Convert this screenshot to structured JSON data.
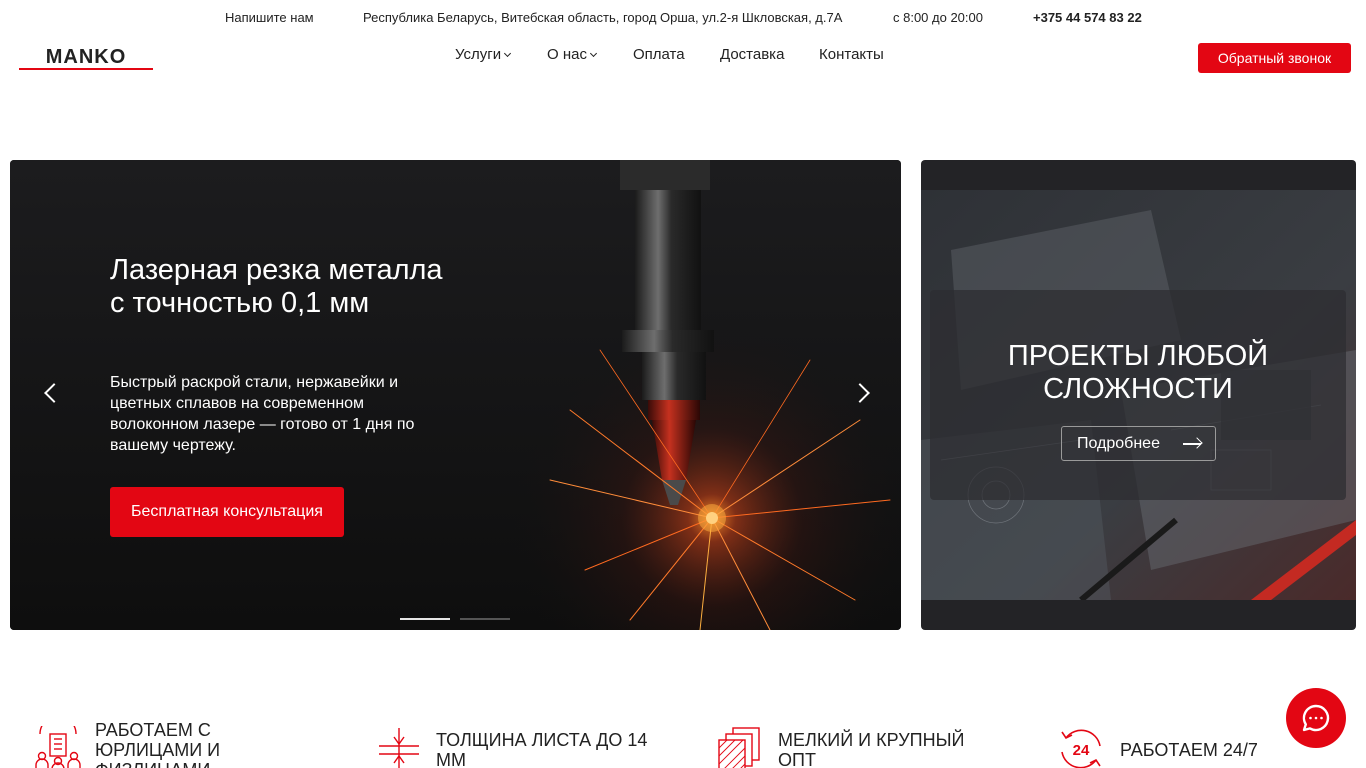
{
  "topbar": {
    "write_us": "Напишите нам",
    "address": "Республика Беларусь, Витебская область, город Орша, ул.2-я Шкловская, д.7А",
    "hours": "с 8:00 до 20:00",
    "phone": "+375 44 574 83 22"
  },
  "header": {
    "logo": "MANKO",
    "nav": {
      "services": "Услуги",
      "about": "О нас",
      "payment": "Оплата",
      "delivery": "Доставка",
      "contacts": "Контакты"
    },
    "callback_label": "Обратный звонок"
  },
  "hero": {
    "title": "Лазерная резка металла с точностью 0,1 мм",
    "text": "Быстрый раскрой стали, нержавейки и цветных сплавов на современном волоконном лазере — готово от 1 дня по вашему чертежу.",
    "cta_label": "Бесплатная консультация",
    "slides_total": 2,
    "active_slide": 1
  },
  "promo": {
    "title": "ПРОЕКТЫ ЛЮБОЙ СЛОЖНОСТИ",
    "more_label": "Подробнее"
  },
  "features": [
    {
      "icon": "office-people-icon",
      "text": "Работаем с юрлицами и физлицами"
    },
    {
      "icon": "sheet-thickness-icon",
      "text": "Толщина листа до 14 мм"
    },
    {
      "icon": "stacked-sheets-icon",
      "text": "Мелкий и крупный опт"
    },
    {
      "icon": "clock-24-icon",
      "text": "Работаем 24/7"
    }
  ],
  "colors": {
    "accent": "#e30613",
    "text": "#222222",
    "dark_panel": "#232326"
  }
}
